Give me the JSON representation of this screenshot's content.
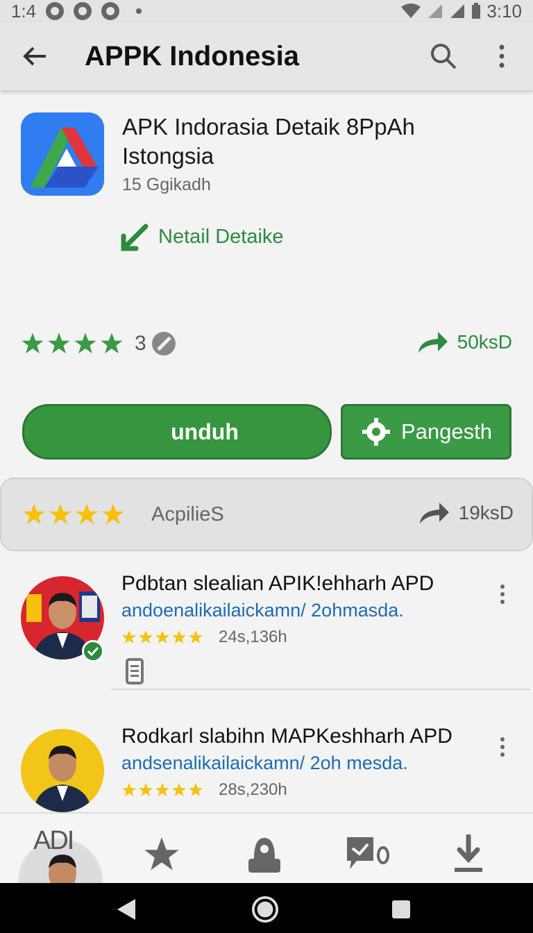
{
  "status_bar": {
    "time_left": "1:4",
    "time_right": "3:10"
  },
  "app_bar": {
    "title": "APPK Indonesia",
    "back_icon": "arrow-back-icon",
    "search_icon": "search-icon",
    "more_icon": "more-vert-icon"
  },
  "app": {
    "name": "APK Indorasia Detaik 8PpAh Istongsia",
    "developer": "15 Ggikadh",
    "detail_link": "Netail Detaike",
    "rating": "3",
    "downloads": "50ksD"
  },
  "actions": {
    "install_label": "unduh",
    "secondary_label": "Pangesth"
  },
  "reviews": {
    "label": "AcpilieS",
    "count": "19ksD"
  },
  "list": [
    {
      "title": "Pdbtan slealian APIK!ehharh APD",
      "subtitle": "andoenalikailaickamn/ 2ohmasda.",
      "meta": "24s,136h"
    },
    {
      "title": "Rodkarl slabihn MAPKeshharh APD",
      "subtitle": "andsenalikailaickamn/ 2oh mesda.",
      "meta": "28s,230h"
    }
  ],
  "bottom_nav": {
    "label": "ADI",
    "items": [
      "home-avatar",
      "star-icon",
      "store-icon",
      "messages-icon",
      "download-icon"
    ]
  },
  "colors": {
    "accent_green": "#36963f",
    "link_blue": "#1e6bb3",
    "star_yellow": "#f4c20d"
  }
}
